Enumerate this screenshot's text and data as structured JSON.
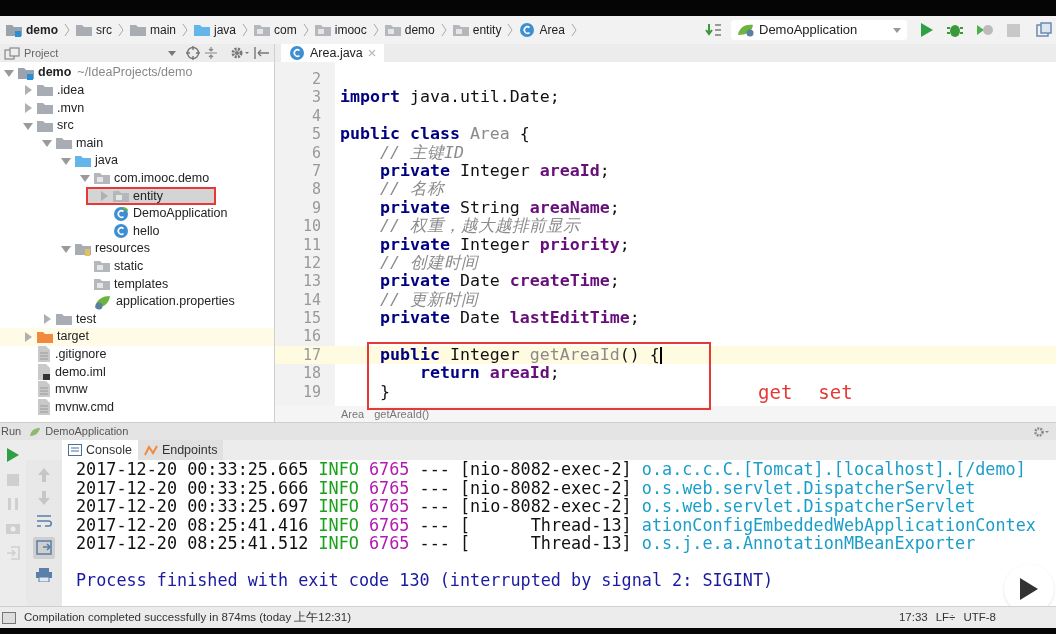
{
  "breadcrumb": [
    {
      "kind": "project",
      "label": "demo"
    },
    {
      "kind": "folder",
      "label": "src"
    },
    {
      "kind": "folder",
      "label": "main"
    },
    {
      "kind": "source-folder",
      "label": "java"
    },
    {
      "kind": "package",
      "label": "com"
    },
    {
      "kind": "package",
      "label": "imooc"
    },
    {
      "kind": "package",
      "label": "demo"
    },
    {
      "kind": "package",
      "label": "entity"
    },
    {
      "kind": "class",
      "label": "Area"
    }
  ],
  "run_config": {
    "label": "DemoApplication"
  },
  "project_panel": {
    "title": "Project"
  },
  "editor_tabs": [
    {
      "label": "Area.java",
      "selected": true
    }
  ],
  "tree": [
    {
      "kind": "project",
      "label": "demo",
      "path": "~/IdeaProjects/demo",
      "expanded": true,
      "selected": false,
      "children": [
        {
          "kind": "folder",
          "label": ".idea",
          "expanded": false,
          "selected": false
        },
        {
          "kind": "folder",
          "label": ".mvn",
          "expanded": false,
          "selected": false
        },
        {
          "kind": "folder",
          "label": "src",
          "expanded": true,
          "selected": false,
          "children": [
            {
              "kind": "folder",
              "label": "main",
              "expanded": true,
              "selected": false,
              "children": [
                {
                  "kind": "source-folder",
                  "label": "java",
                  "expanded": true,
                  "selected": false,
                  "children": [
                    {
                      "kind": "package",
                      "label": "com.imooc.demo",
                      "expanded": true,
                      "selected": false,
                      "children": [
                        {
                          "kind": "package",
                          "label": "entity",
                          "expanded": false,
                          "selected": true
                        },
                        {
                          "kind": "spring-class",
                          "label": "DemoApplication",
                          "selected": false
                        },
                        {
                          "kind": "class",
                          "label": "hello",
                          "selected": false
                        }
                      ]
                    }
                  ]
                },
                {
                  "kind": "resources",
                  "label": "resources",
                  "expanded": true,
                  "selected": false,
                  "children": [
                    {
                      "kind": "package",
                      "label": "static",
                      "selected": false
                    },
                    {
                      "kind": "package",
                      "label": "templates",
                      "selected": false
                    },
                    {
                      "kind": "properties",
                      "label": "application.properties",
                      "selected": false
                    }
                  ]
                }
              ]
            },
            {
              "kind": "folder",
              "label": "test",
              "expanded": false,
              "selected": false
            }
          ]
        },
        {
          "kind": "excluded",
          "label": "target",
          "expanded": false,
          "selected": false
        },
        {
          "kind": "file",
          "label": ".gitignore",
          "selected": false
        },
        {
          "kind": "module",
          "label": "demo.iml",
          "selected": false
        },
        {
          "kind": "file",
          "label": "mvnw",
          "selected": false
        },
        {
          "kind": "file",
          "label": "mvnw.cmd",
          "selected": false
        }
      ]
    }
  ],
  "code_lines": [
    {
      "number": "2",
      "current": false
    },
    {
      "number": "3",
      "current": false,
      "tokens": [
        {
          "kind": "keyword",
          "text": "import"
        },
        {
          "kind": "plain",
          "text": " java.util.Date;"
        }
      ]
    },
    {
      "number": "4",
      "current": false
    },
    {
      "number": "5",
      "current": false,
      "tokens": [
        {
          "kind": "keyword",
          "text": "public class"
        },
        {
          "kind": "unused",
          "text": " Area"
        },
        {
          "kind": "plain",
          "text": " {"
        }
      ]
    },
    {
      "number": "6",
      "current": false,
      "tokens": [
        {
          "kind": "comment",
          "text": "    // 主键ID"
        }
      ]
    },
    {
      "number": "7",
      "current": false,
      "tokens": [
        {
          "kind": "keyword",
          "text": "    private"
        },
        {
          "kind": "plain",
          "text": " Integer "
        },
        {
          "kind": "field",
          "text": "areaId"
        },
        {
          "kind": "plain",
          "text": ";"
        }
      ]
    },
    {
      "number": "8",
      "current": false,
      "tokens": [
        {
          "kind": "comment",
          "text": "    // 名称"
        }
      ]
    },
    {
      "number": "9",
      "current": false,
      "tokens": [
        {
          "kind": "keyword",
          "text": "    private"
        },
        {
          "kind": "plain",
          "text": " String "
        },
        {
          "kind": "field",
          "text": "areaName"
        },
        {
          "kind": "plain",
          "text": ";"
        }
      ]
    },
    {
      "number": "10",
      "current": false,
      "tokens": [
        {
          "kind": "comment",
          "text": "    // 权重，越大越排前显示"
        }
      ]
    },
    {
      "number": "11",
      "current": false,
      "tokens": [
        {
          "kind": "keyword",
          "text": "    private"
        },
        {
          "kind": "plain",
          "text": " Integer "
        },
        {
          "kind": "field",
          "text": "priority"
        },
        {
          "kind": "plain",
          "text": ";"
        }
      ]
    },
    {
      "number": "12",
      "current": false,
      "tokens": [
        {
          "kind": "comment",
          "text": "    // 创建时间"
        }
      ]
    },
    {
      "number": "13",
      "current": false,
      "tokens": [
        {
          "kind": "keyword",
          "text": "    private"
        },
        {
          "kind": "plain",
          "text": " Date "
        },
        {
          "kind": "field",
          "text": "createTime"
        },
        {
          "kind": "plain",
          "text": ";"
        }
      ]
    },
    {
      "number": "14",
      "current": false,
      "tokens": [
        {
          "kind": "comment",
          "text": "    // 更新时间"
        }
      ]
    },
    {
      "number": "15",
      "current": false,
      "tokens": [
        {
          "kind": "keyword",
          "text": "    private"
        },
        {
          "kind": "plain",
          "text": " Date "
        },
        {
          "kind": "field",
          "text": "lastEditTime"
        },
        {
          "kind": "plain",
          "text": ";"
        }
      ]
    },
    {
      "number": "16",
      "current": false
    },
    {
      "number": "17",
      "current": true,
      "tokens": [
        {
          "kind": "keyword",
          "text": "    public"
        },
        {
          "kind": "plain",
          "text": " Integer "
        },
        {
          "kind": "unused",
          "text": "getAreaId"
        },
        {
          "kind": "plain",
          "text": "() {"
        }
      ]
    },
    {
      "number": "18",
      "current": false,
      "tokens": [
        {
          "kind": "keyword",
          "text": "        return"
        },
        {
          "kind": "field",
          "text": " areaId"
        },
        {
          "kind": "plain",
          "text": ";"
        }
      ]
    },
    {
      "number": "19",
      "current": false,
      "tokens": [
        {
          "kind": "plain",
          "text": "    }"
        }
      ]
    }
  ],
  "editor_breadcrumb": [
    "Area",
    "getAreaId()"
  ],
  "annotation_texts": [
    "get",
    "set"
  ],
  "run_panel": {
    "title": "Run",
    "config": "DemoApplication",
    "tabs": [
      {
        "kind": "console",
        "label": "Console",
        "selected": true
      },
      {
        "kind": "endpoints",
        "label": "Endpoints",
        "selected": false
      }
    ],
    "log": [
      {
        "time": "2017-12-20 00:33:25.665",
        "level": "INFO",
        "pid": "6765",
        "sep": "---",
        "thread": "[nio-8082-exec-2]",
        "logger": "o.a.c.c.C.[Tomcat].[localhost].[/demo]"
      },
      {
        "time": "2017-12-20 00:33:25.666",
        "level": "INFO",
        "pid": "6765",
        "sep": "---",
        "thread": "[nio-8082-exec-2]",
        "logger": "o.s.web.servlet.DispatcherServlet"
      },
      {
        "time": "2017-12-20 00:33:25.697",
        "level": "INFO",
        "pid": "6765",
        "sep": "---",
        "thread": "[nio-8082-exec-2]",
        "logger": "o.s.web.servlet.DispatcherServlet"
      },
      {
        "time": "2017-12-20 08:25:41.416",
        "level": "INFO",
        "pid": "6765",
        "sep": "---",
        "thread": "[      Thread-13]",
        "logger": "ationConfigEmbeddedWebApplicationContex"
      },
      {
        "time": "2017-12-20 08:25:41.512",
        "level": "INFO",
        "pid": "6765",
        "sep": "---",
        "thread": "[      Thread-13]",
        "logger": "o.s.j.e.a.AnnotationMBeanExporter"
      }
    ],
    "exit_message": "Process finished with exit code 130 (interrupted by signal 2: SIGINT)"
  },
  "status_bar": {
    "message": "Compilation completed successfully in 874ms (today 上午12:31)",
    "position": "17:33",
    "line_separator": "LF÷",
    "encoding": "UTF-8"
  }
}
